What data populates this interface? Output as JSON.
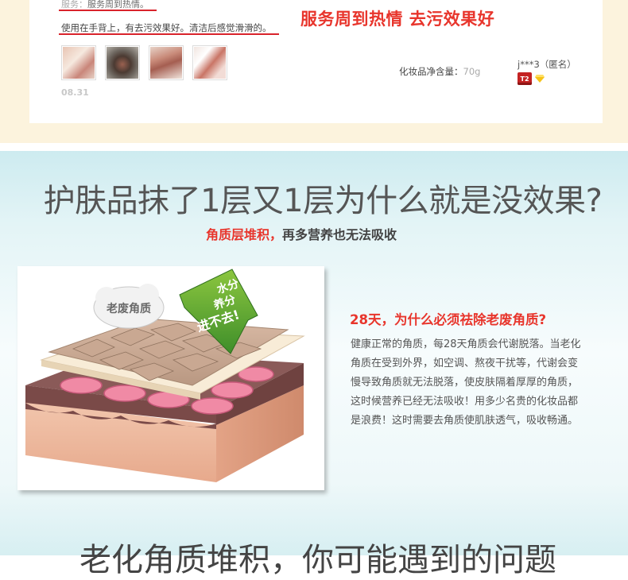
{
  "review": {
    "service_label": "服务：",
    "service_text": "服务周到热情。",
    "text": "使用在手背上，有去污效果好。清洁后感觉滑滑的。",
    "highlight": "服务周到热情 去污效果好",
    "date": "08.31",
    "spec_label": "化妆品净含量：",
    "spec_value": "70g",
    "user": "j***3（匿名）",
    "level_badge": "T2",
    "photos": [
      "review-photo-1",
      "review-photo-2",
      "review-photo-3",
      "review-photo-4"
    ]
  },
  "section": {
    "headline": "护肤品抹了1层又1层为什么就是没效果?",
    "sub_red": "角质层堆积，",
    "sub_rest": "再多营养也无法吸收",
    "illustration": {
      "bubble_label": "老废角质",
      "arrow_text_1": "水分",
      "arrow_text_2": "养分",
      "arrow_text_3": "进不去!"
    },
    "question": "28天，为什么必须祛除老废角质?",
    "paragraph": "健康正常的角质，每28天角质会代谢脱落。当老化角质在受到外界，如空调、熬夜干扰等，代谢会变慢导致角质就无法脱落，使皮肤隔着厚厚的角质，这时候营养已经无法吸收！用多少名贵的化妆品都是浪费！这时需要去角质使肌肤透气，吸收畅通。",
    "bottom_title": "老化角质堆积，你可能遇到的问题"
  },
  "colors": {
    "accent_red": "#e8352c",
    "review_bg": "#fcf3dd",
    "section_bg": "#d8f0f3"
  }
}
